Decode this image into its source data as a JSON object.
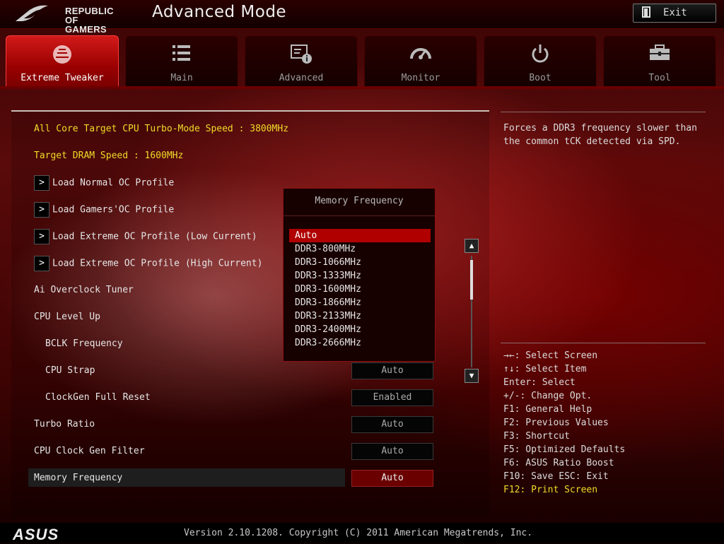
{
  "brand": {
    "logo_line1": "REPUBLIC OF",
    "logo_line2": "GAMERS",
    "footer_logo": "ASUS"
  },
  "header": {
    "title": "Advanced Mode",
    "exit_label": "Exit"
  },
  "tabs": [
    {
      "label": "Extreme Tweaker",
      "icon": "tweaker-icon",
      "active": true
    },
    {
      "label": "Main",
      "icon": "list-icon",
      "active": false
    },
    {
      "label": "Advanced",
      "icon": "advanced-icon",
      "active": false
    },
    {
      "label": "Monitor",
      "icon": "gauge-icon",
      "active": false
    },
    {
      "label": "Boot",
      "icon": "power-icon",
      "active": false
    },
    {
      "label": "Tool",
      "icon": "toolbox-icon",
      "active": false
    }
  ],
  "settings": {
    "all_core_speed": "All Core Target CPU Turbo-Mode Speed : 3800MHz",
    "target_dram": "Target DRAM Speed : 1600MHz",
    "load_normal": "Load Normal OC Profile",
    "load_gamers": "Load Gamers'OC Profile",
    "load_extreme_low": "Load Extreme OC Profile (Low Current)",
    "load_extreme_high": "Load Extreme OC Profile (High Current)",
    "ai_tuner": "Ai Overclock Tuner",
    "cpu_level_up": "CPU Level Up",
    "bclk": "BCLK Frequency",
    "cpu_strap": {
      "label": "CPU Strap",
      "value": "Auto"
    },
    "clockgen_reset": {
      "label": "ClockGen Full Reset",
      "value": "Enabled"
    },
    "turbo_ratio": {
      "label": "Turbo Ratio",
      "value": "Auto"
    },
    "clock_gen_filter": {
      "label": "CPU Clock Gen Filter",
      "value": "Auto"
    },
    "memory_frequency": {
      "label": "Memory Frequency",
      "value": "Auto"
    }
  },
  "popup": {
    "title": "Memory Frequency",
    "options": [
      "Auto",
      "DDR3-800MHz",
      "DDR3-1066MHz",
      "DDR3-1333MHz",
      "DDR3-1600MHz",
      "DDR3-1866MHz",
      "DDR3-2133MHz",
      "DDR3-2400MHz",
      "DDR3-2666MHz"
    ],
    "selected": "Auto"
  },
  "help": {
    "text": "Forces a DDR3 frequency slower than the common tCK detected via SPD."
  },
  "keys": [
    "→←: Select Screen",
    "↑↓: Select Item",
    "Enter: Select",
    "+/-: Change Opt.",
    "F1: General Help",
    "F2: Previous Values",
    "F3: Shortcut",
    "F5: Optimized Defaults",
    "F6: ASUS Ratio Boost",
    "F10: Save  ESC: Exit",
    "F12: Print Screen"
  ],
  "footer": {
    "version": "Version 2.10.1208. Copyright (C) 2011 American Megatrends, Inc."
  },
  "colors": {
    "accent": "#b00000",
    "highlight_text": "#f0dc2a"
  }
}
